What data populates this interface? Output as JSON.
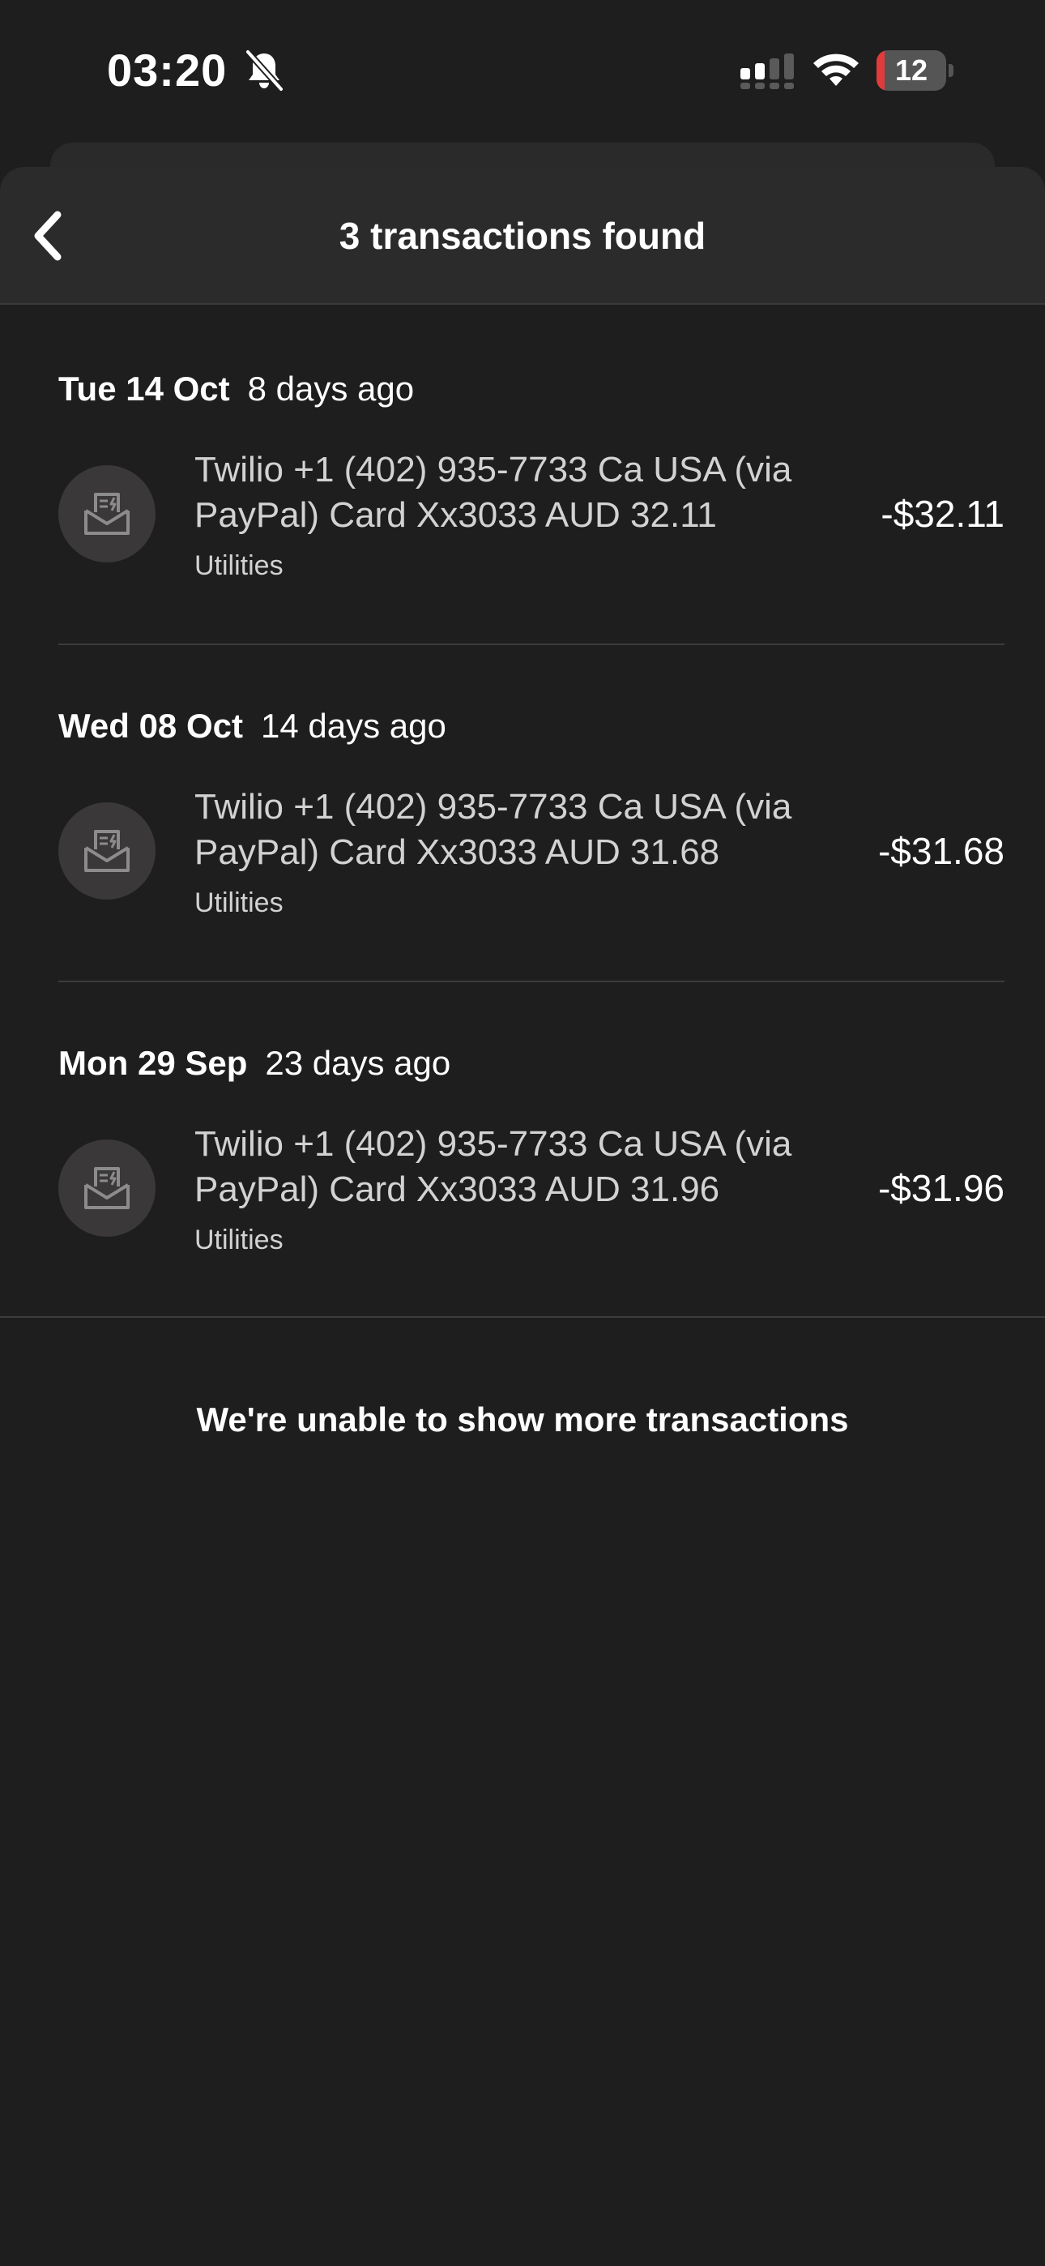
{
  "status_bar": {
    "time": "03:20",
    "battery_level": "12",
    "battery_fraction": 0.12,
    "icons": [
      "bell-slash-icon",
      "cellular-signal-icon",
      "wifi-icon",
      "battery-icon"
    ]
  },
  "header": {
    "title": "3 transactions found",
    "back_icon": "chevron-left-icon"
  },
  "transactions": [
    {
      "date": "Tue 14 Oct",
      "ago": "8 days ago",
      "description": "Twilio +1 (402) 935-7733 Ca USA (via PayPal) Card Xx3033 AUD 32.11",
      "category": "Utilities",
      "amount": "-$32.11",
      "icon": "utilities-envelope-icon"
    },
    {
      "date": "Wed 08 Oct",
      "ago": "14 days ago",
      "description": "Twilio +1 (402) 935-7733 Ca USA (via PayPal) Card Xx3033 AUD 31.68",
      "category": "Utilities",
      "amount": "-$31.68",
      "icon": "utilities-envelope-icon"
    },
    {
      "date": "Mon 29 Sep",
      "ago": "23 days ago",
      "description": "Twilio +1 (402) 935-7733 Ca USA (via PayPal) Card Xx3033 AUD 31.96",
      "category": "Utilities",
      "amount": "-$31.96",
      "icon": "utilities-envelope-icon"
    }
  ],
  "footer": {
    "message": "We're unable to show more transactions"
  },
  "colors": {
    "background": "#1e1e1e",
    "header_background": "#2b2b2b",
    "avatar_background": "#3a3838",
    "battery_low": "#e23b3b"
  }
}
